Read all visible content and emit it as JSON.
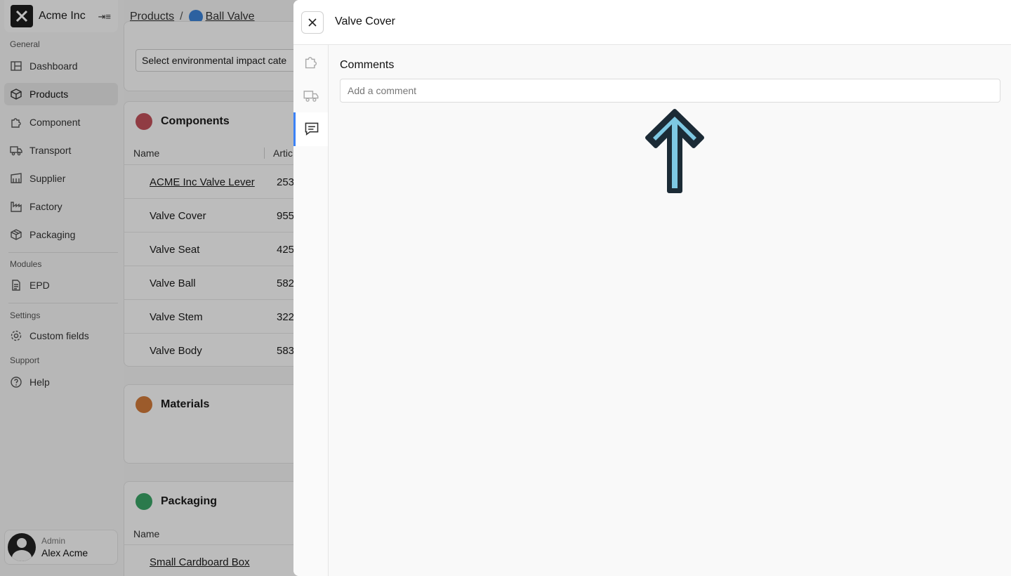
{
  "org": {
    "name": "Acme Inc"
  },
  "sidebar": {
    "sections": {
      "general": "General",
      "modules": "Modules",
      "settings": "Settings",
      "support": "Support"
    },
    "items": [
      {
        "label": "Dashboard",
        "icon": "dashboard-icon"
      },
      {
        "label": "Products",
        "icon": "box-icon",
        "active": true
      },
      {
        "label": "Component",
        "icon": "puzzle-icon"
      },
      {
        "label": "Transport",
        "icon": "truck-icon"
      },
      {
        "label": "Supplier",
        "icon": "supplier-icon"
      },
      {
        "label": "Factory",
        "icon": "factory-icon"
      },
      {
        "label": "Packaging",
        "icon": "package-icon"
      },
      {
        "label": "EPD",
        "icon": "document-icon"
      },
      {
        "label": "Custom fields",
        "icon": "gear-icon"
      },
      {
        "label": "Help",
        "icon": "help-icon"
      }
    ]
  },
  "user": {
    "role": "Admin",
    "name": "Alex Acme"
  },
  "breadcrumb": {
    "parent": "Products",
    "current": "Ball Valve"
  },
  "impact_select": {
    "placeholder": "Select environmental impact cate"
  },
  "components": {
    "title": "Components",
    "columns": [
      "Name",
      "Artic"
    ],
    "rows": [
      {
        "name": "ACME Inc Valve Lever",
        "article": "253"
      },
      {
        "name": "Valve Cover",
        "article": "955"
      },
      {
        "name": "Valve Seat",
        "article": "425"
      },
      {
        "name": "Valve Ball",
        "article": "582"
      },
      {
        "name": "Valve Stem",
        "article": "322"
      },
      {
        "name": "Valve Body",
        "article": "583"
      }
    ]
  },
  "materials": {
    "title": "Materials"
  },
  "packaging": {
    "title": "Packaging",
    "columns": [
      "Name"
    ],
    "rows": [
      {
        "name": "Small Cardboard Box"
      }
    ]
  },
  "drawer": {
    "title": "Valve Cover",
    "comments_label": "Comments",
    "comment_placeholder": "Add a comment"
  },
  "colors": {
    "accent": "#3b82f6",
    "components_icon": "#c0505a",
    "materials_icon": "#d07a3a",
    "packaging_icon": "#3aa366",
    "arrow_fill": "#7ec8e3",
    "arrow_stroke": "#1c2b36"
  }
}
